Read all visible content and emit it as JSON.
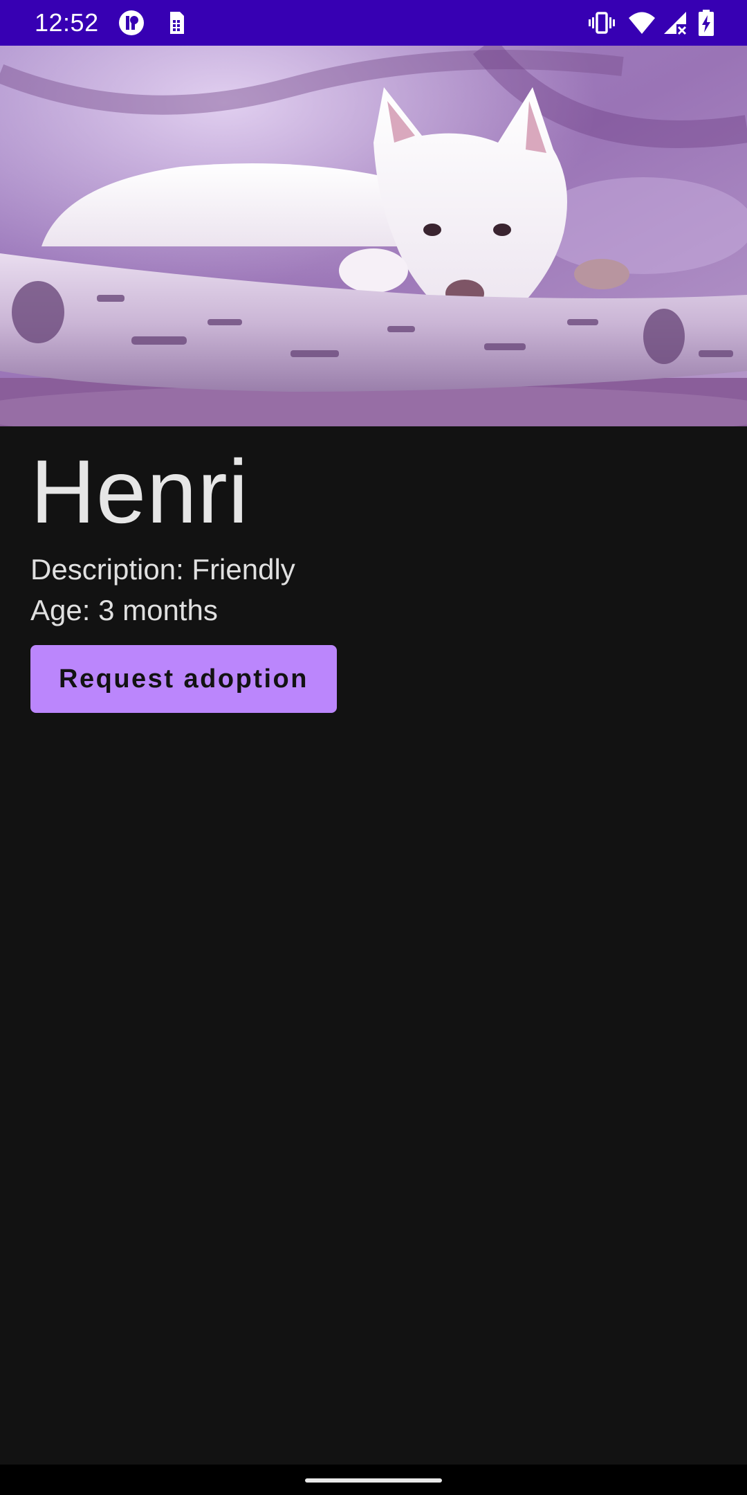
{
  "status_bar": {
    "time": "12:52",
    "background": "#3700b3",
    "left_icons": [
      "app-notification-icon",
      "sim-card-icon"
    ],
    "right_icons": [
      "vibrate-icon",
      "wifi-icon",
      "signal-no-data-icon",
      "battery-charging-icon"
    ]
  },
  "hero": {
    "image": "white-dog-lying-on-birch-log-photo"
  },
  "pet": {
    "name": "Henri",
    "description": "Description: Friendly",
    "age": "Age: 3 months"
  },
  "actions": {
    "adopt_label": "Request adoption",
    "adopt_color": "#bb86fc"
  },
  "theme": {
    "background": "#121212",
    "text": "#e0e0e0"
  }
}
